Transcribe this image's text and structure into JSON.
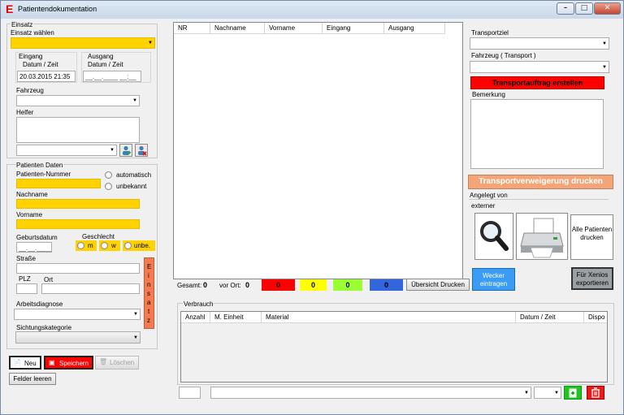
{
  "window": {
    "title": "Patientendokumentation",
    "logo_letter": "E",
    "min_glyph": "–",
    "max_glyph": "□",
    "close_glyph": "✕"
  },
  "einsatz": {
    "group_label": "Einsatz",
    "select_label": "Einsatz wählen",
    "select_value": "",
    "eingang_label": "Eingang",
    "eingang_sub": "Datum / Zeit",
    "eingang_value": "20.03.2015 21:35",
    "ausgang_label": "Ausgang",
    "ausgang_sub": "Datum / Zeit",
    "ausgang_value": "__.__.____ __:__",
    "fahrzeug_label": "Fahrzeug",
    "helfer_label": "Helfer",
    "einsatz_vertical": [
      "E",
      "i",
      "n",
      "s",
      "a",
      "t",
      "z"
    ]
  },
  "patient": {
    "group_label": "Patienten Daten",
    "nummer_label": "Patienten-Nummer",
    "radio_automatisch": "automatisch",
    "radio_unbekannt": "unbekannt",
    "nachname_label": "Nachname",
    "vorname_label": "Vorname",
    "geburtsdatum_label": "Geburtsdatum",
    "geburtsdatum_value": "__.__.____",
    "geschlecht_label": "Geschlecht",
    "geschlecht_m": "m",
    "geschlecht_w": "w",
    "geschlecht_unbe": "unbe.",
    "strasse_label": "Straße",
    "plz_label": "PLZ",
    "ort_label": "Ort",
    "arbeitsdiagnose_label": "Arbeitsdiagnose",
    "sichtung_label": "Sichtungskategorie"
  },
  "actions": {
    "neu": "Neu",
    "speichern": "Speichern",
    "loeschen": "Löschen",
    "felder_leeren": "Felder leeren"
  },
  "table": {
    "columns": [
      "NR",
      "Nachname",
      "Vorname",
      "Eingang",
      "Ausgang"
    ]
  },
  "counters": {
    "gesamt_label": "Gesamt:",
    "gesamt_value": "0",
    "vorort_label": "vor Ort:",
    "vorort_value": "0",
    "red": "0",
    "yellow": "0",
    "green": "0",
    "blue": "0",
    "colors": {
      "red": "#ff0000",
      "yellow": "#ffff00",
      "green": "#99ff33",
      "blue": "#3366dd"
    },
    "uebersicht_button": "Übersicht Drucken"
  },
  "wecker_button": "Wecker eintragen",
  "xenios_button": "Für Xenios exportieren",
  "transport": {
    "ziel_label": "Transportziel",
    "fahrzeug_label": "Fahrzeug ( Transport )",
    "auftrag_button": "Transportauftrag erstellen",
    "bemerkung_label": "Bemerkung",
    "verweigerung_button": "Transportverweigerung drucken",
    "angelegt_label": "Angelegt von",
    "angelegt_value": "externer",
    "alle_drucken_button": "Alle Patienten drucken"
  },
  "verbrauch": {
    "group_label": "Verbrauch",
    "columns": [
      "Anzahl",
      "M. Einheit",
      "Material",
      "Datum / Zeit",
      "Dispo"
    ]
  },
  "icons": {
    "search": "magnifier-icon",
    "printer": "printer-icon",
    "add": "add-icon",
    "delete": "trash-icon"
  }
}
